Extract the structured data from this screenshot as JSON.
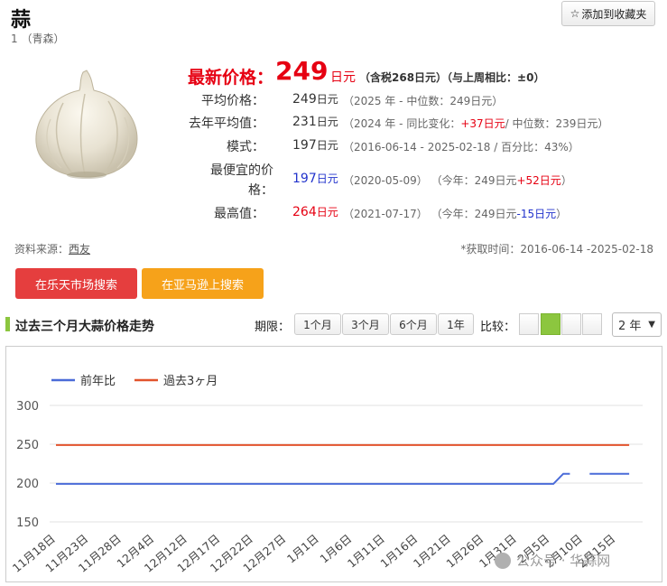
{
  "header": {
    "title": "蒜",
    "subtitle": "1 （青森）",
    "favorite_icon": "star-outline-icon",
    "favorite_label": "添加到收藏夹"
  },
  "product_image": "garlic-bulb",
  "price": {
    "latest_label": "最新价格：",
    "latest_value": "249",
    "latest_unit": "日元",
    "latest_note": "（含税268日元）（与上周相比：±0）",
    "rows": [
      {
        "label": "平均价格：",
        "value": "249",
        "unit": "日元",
        "note_a": "（2025 年 - 中位数：249日元）",
        "note_b": "",
        "note_c": "",
        "note_d": ""
      },
      {
        "label": "去年平均值：",
        "value": "231",
        "unit": "日元",
        "note_a": "（2024 年 - 同比变化：",
        "note_b": "+37日元",
        "note_c": "/ 中位数：239日元）",
        "note_d": ""
      },
      {
        "label": "模式：",
        "value": "197",
        "unit": "日元",
        "note_a": "（2016-06-14 - 2025-02-18 / 百分比：43%）",
        "note_b": "",
        "note_c": "",
        "note_d": ""
      },
      {
        "label": "最便宜的价格：",
        "value": "197",
        "unit": "日元",
        "note_a": "（2020-05-09）",
        "note_b": "（今年：249日元",
        "note_c": "+52日元",
        "note_d": "）"
      },
      {
        "label": "最高值：",
        "value": "264",
        "unit": "日元",
        "note_a": "（2021-07-17）",
        "note_b": "（今年：249日元",
        "note_c": "-15日元",
        "note_d": "）"
      }
    ],
    "colors": {
      "accent_red": "#e60012",
      "low_blue": "#2233cc"
    }
  },
  "source": {
    "label": "资料来源：",
    "name": "西友",
    "period": "*获取时间：2016-06-14 -2025-02-18"
  },
  "search_buttons": {
    "rakuten": "在乐天市场搜索",
    "amazon": "在亚马逊上搜索"
  },
  "trend": {
    "title": "过去三个月大蒜价格走势",
    "period_label": "期限：",
    "period_tabs": [
      "1个月",
      "3个月",
      "6个月",
      "1年"
    ],
    "compare_label": "比较：",
    "compare_selected_index": 1,
    "year_select": "2 年"
  },
  "watermark": "公众号 · 华蒜网",
  "chart_data": {
    "type": "line",
    "title": "",
    "xlabel": "",
    "ylabel": "",
    "ylim": [
      150,
      300
    ],
    "yticks": [
      150,
      200,
      250,
      300
    ],
    "grid": true,
    "legend_position": "top-left",
    "categories": [
      "11月18日",
      "11月23日",
      "11月28日",
      "12月4日",
      "12月12日",
      "12月17日",
      "12月22日",
      "12月27日",
      "1月1日",
      "1月6日",
      "1月11日",
      "1月16日",
      "1月21日",
      "1月26日",
      "1月31日",
      "2月5日",
      "2月10日",
      "2月15日"
    ],
    "series": [
      {
        "name": "前年比",
        "color": "#4a6bd8",
        "points": [
          {
            "x": 0,
            "y": 199
          },
          {
            "x": 15.1,
            "y": 199
          },
          {
            "x": 15.4,
            "y": 212
          },
          {
            "x": 15.6,
            "y": 212
          },
          {
            "x": null,
            "y": null
          },
          {
            "x": 16.2,
            "y": 212
          },
          {
            "x": 17.4,
            "y": 212
          }
        ]
      },
      {
        "name": "過去3ヶ月",
        "color": "#e2532c",
        "points": [
          {
            "x": 0,
            "y": 249
          },
          {
            "x": 17.4,
            "y": 249
          }
        ]
      }
    ]
  }
}
